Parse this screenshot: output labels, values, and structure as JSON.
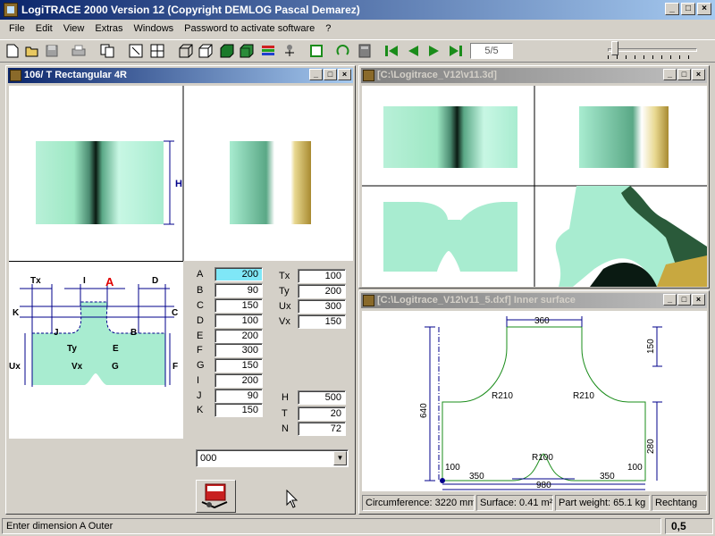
{
  "app": {
    "title": "LogiTRACE 2000  Version 12  (Copyright DEMLOG Pascal Demarez)",
    "caption_buttons": {
      "minimize": "_",
      "maximize": "□",
      "close": "×"
    }
  },
  "menu": [
    "File",
    "Edit",
    "View",
    "Extras",
    "Windows",
    "Password to activate software",
    "?"
  ],
  "toolbar": {
    "counter": "5/5",
    "colors": {
      "green_nav": "#1a8c1a",
      "green_fill": "#2a8c3a"
    }
  },
  "window_main": {
    "title": "106/ T Rectangular 4R",
    "diagram_labels": {
      "H": "H",
      "Tx": "Tx",
      "I": "I",
      "A": "A",
      "D": "D",
      "K": "K",
      "C": "C",
      "J": "J",
      "Ty": "Ty",
      "E": "E",
      "B": "B",
      "Ux": "Ux",
      "Vx": "Vx",
      "G": "G",
      "F": "F"
    },
    "params_left": [
      {
        "label": "A",
        "value": "200"
      },
      {
        "label": "B",
        "value": "90"
      },
      {
        "label": "C",
        "value": "150"
      },
      {
        "label": "D",
        "value": "100"
      },
      {
        "label": "E",
        "value": "200"
      },
      {
        "label": "F",
        "value": "300"
      },
      {
        "label": "G",
        "value": "150"
      },
      {
        "label": "I",
        "value": "200"
      },
      {
        "label": "J",
        "value": "90"
      },
      {
        "label": "K",
        "value": "150"
      }
    ],
    "params_right_top": [
      {
        "label": "Tx",
        "value": "100"
      },
      {
        "label": "Ty",
        "value": "200"
      },
      {
        "label": "Ux",
        "value": "300"
      },
      {
        "label": "Vx",
        "value": "150"
      }
    ],
    "params_right_bottom": [
      {
        "label": "H",
        "value": "500"
      },
      {
        "label": "T",
        "value": "20"
      },
      {
        "label": "N",
        "value": "72"
      }
    ],
    "combo_value": "000"
  },
  "window_3d": {
    "title": "[C:\\Logitrace_V12\\v11.3d]"
  },
  "window_dxf": {
    "title": "[C:\\Logitrace_V12\\v11_5.dxf]  Inner surface",
    "dims": {
      "top": "360",
      "right_top": "150",
      "height": "640",
      "r_left": "R210",
      "r_right": "R210",
      "right_mid": "280",
      "r_center": "R100",
      "left_100": "100",
      "left_350": "350",
      "right_350": "350",
      "right_100": "100",
      "bottom": "980"
    },
    "status": {
      "circumference": "Circumference: 3220 mm",
      "surface": "Surface: 0.41 m²",
      "weight": "Part weight: 65.1 kg",
      "type": "Rechtang"
    }
  },
  "status_bar": {
    "message": "Enter dimension A Outer",
    "value": "0,5"
  }
}
